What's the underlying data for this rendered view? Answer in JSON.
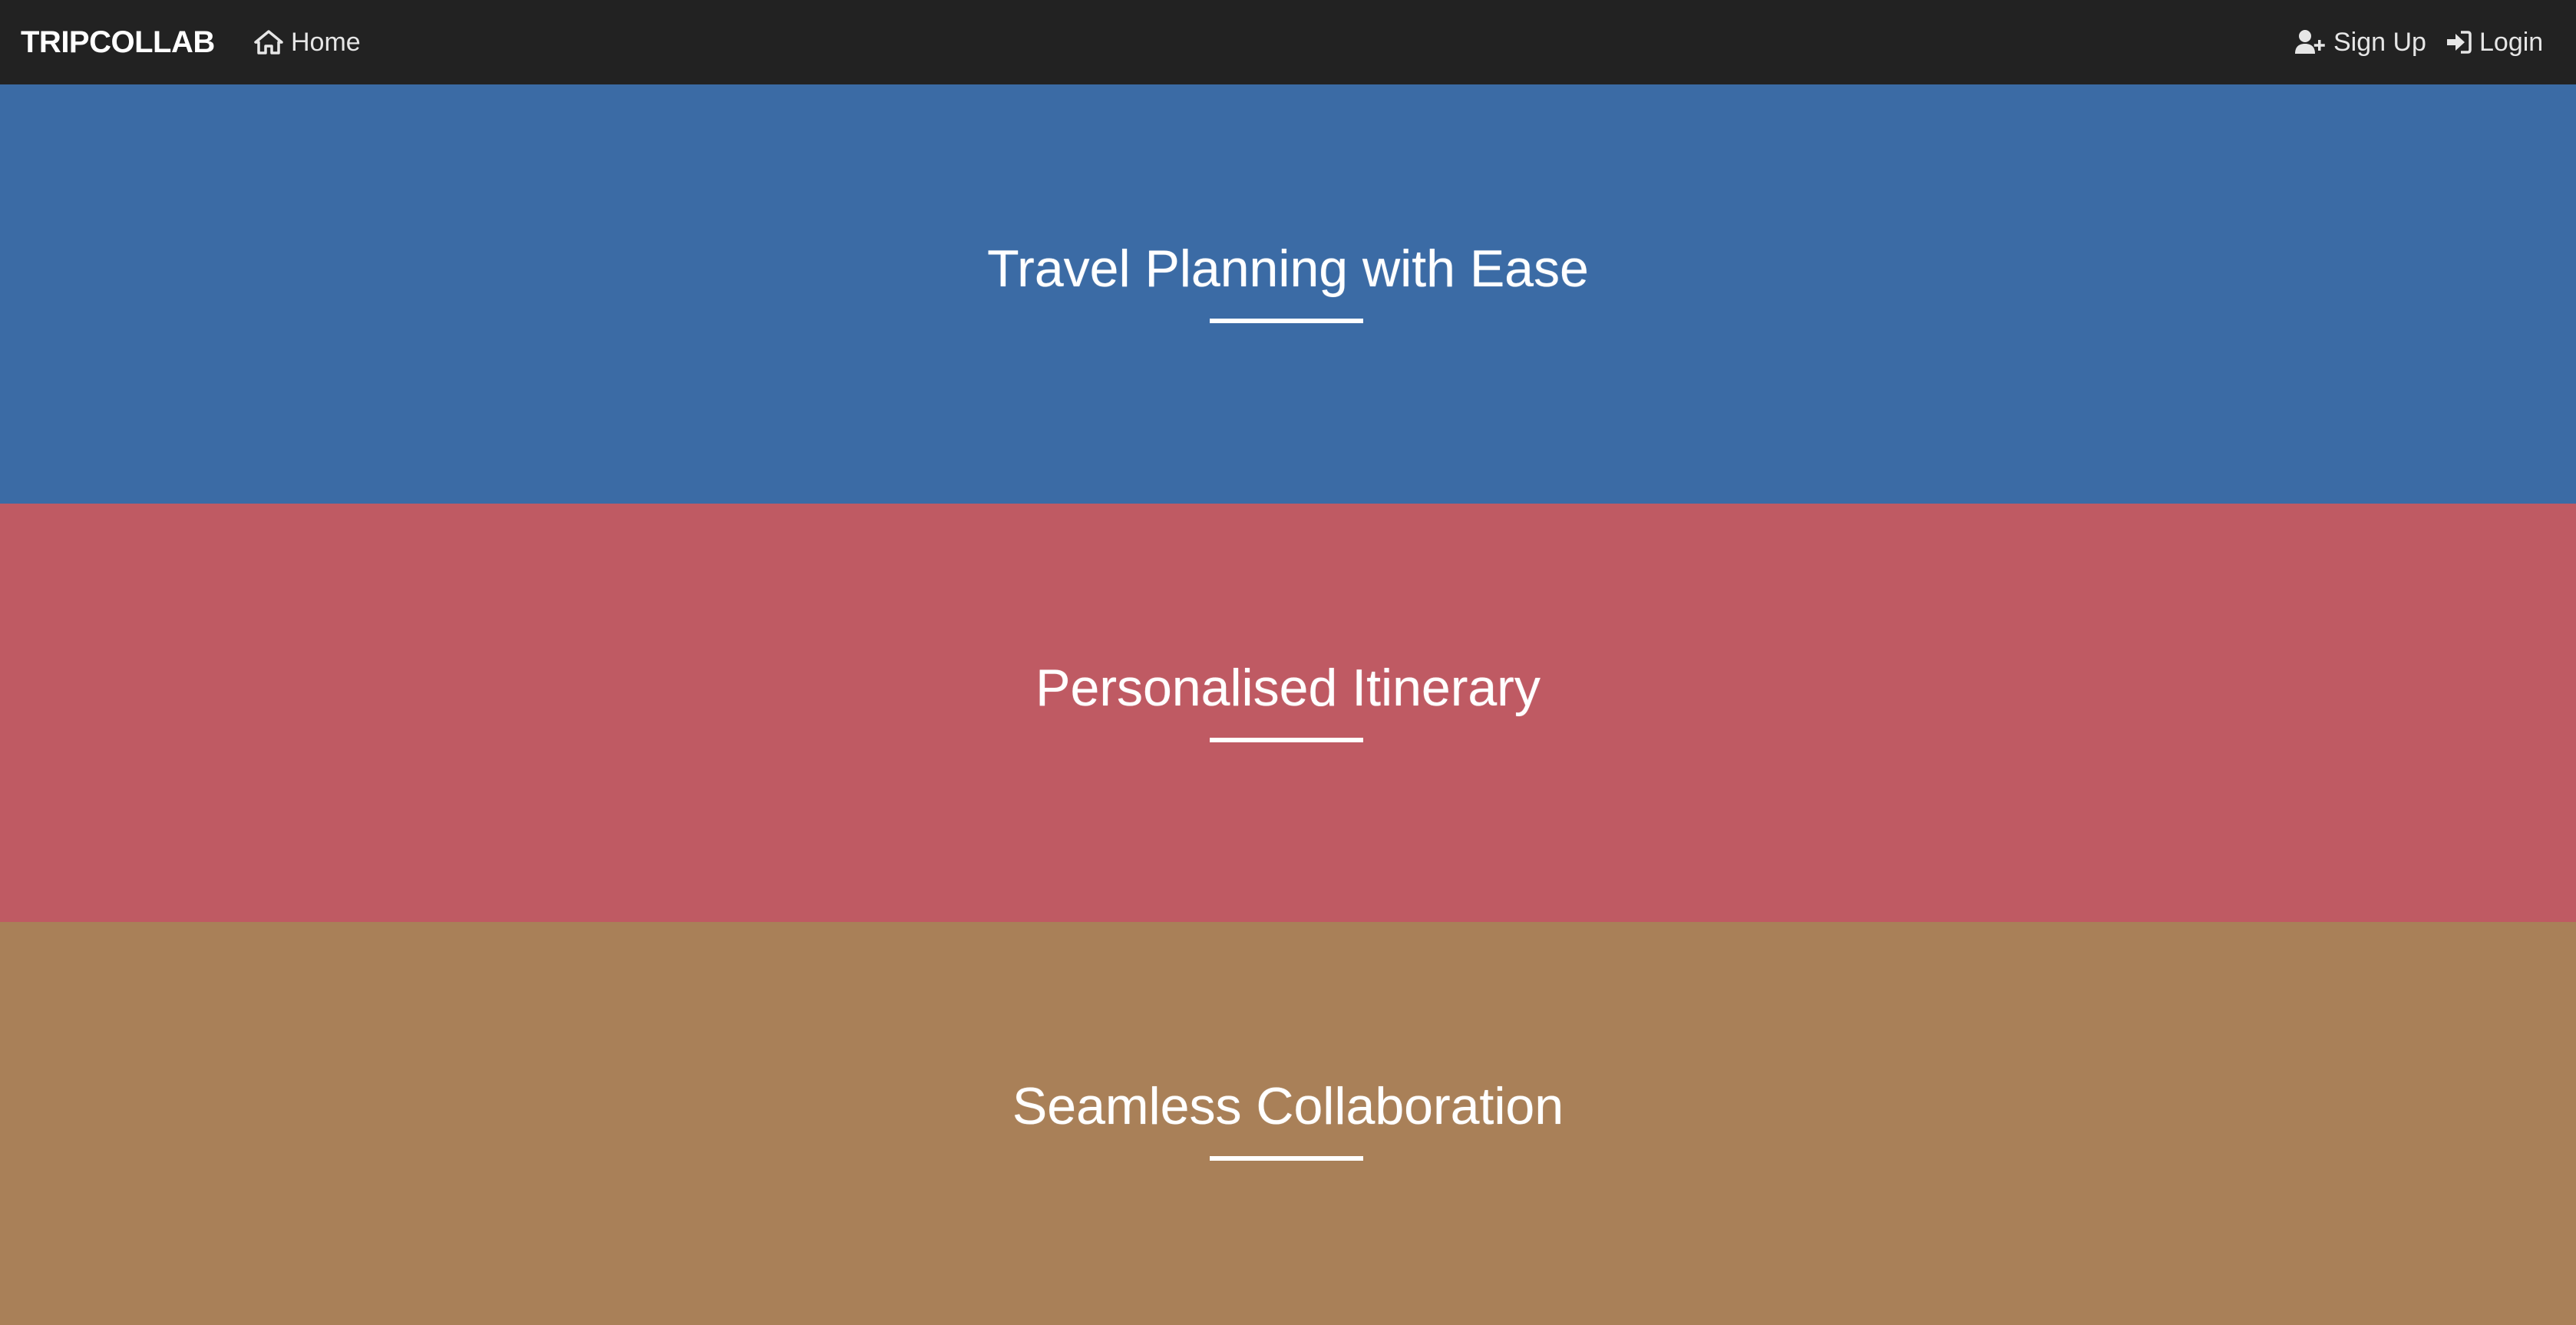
{
  "navbar": {
    "brand": "TRIPCOLLAB",
    "home_label": "Home",
    "signup_label": "Sign Up",
    "login_label": "Login",
    "home_icon": "home-icon",
    "signup_icon": "user-plus-icon",
    "login_icon": "sign-in-icon",
    "background_color": "#222222"
  },
  "sections": [
    {
      "title": "Travel Planning with Ease",
      "background_color": "#3B6BA5"
    },
    {
      "title": "Personalised Itinerary",
      "background_color": "#BF5A63"
    },
    {
      "title": "Seamless Collaboration",
      "background_color": "#A98058"
    }
  ]
}
